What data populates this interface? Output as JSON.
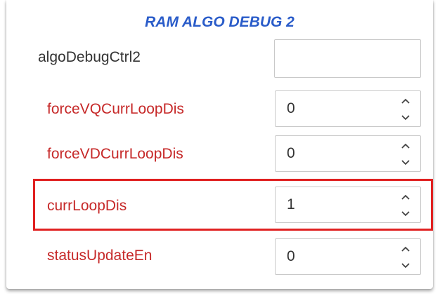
{
  "panel": {
    "title": "RAM ALGO DEBUG 2",
    "header_label": "algoDebugCtrl2",
    "header_value": "",
    "fields": [
      {
        "label": "forceVQCurrLoopDis",
        "value": "0"
      },
      {
        "label": "forceVDCurrLoopDis",
        "value": "0"
      },
      {
        "label": "currLoopDis",
        "value": "1"
      },
      {
        "label": "statusUpdateEn",
        "value": "0"
      }
    ]
  },
  "colors": {
    "title": "#2a5cc9",
    "field_label": "#c62828",
    "highlight": "#e02020"
  },
  "icons": {
    "stepper_up": "chevron-up-icon",
    "stepper_down": "chevron-down-icon"
  }
}
